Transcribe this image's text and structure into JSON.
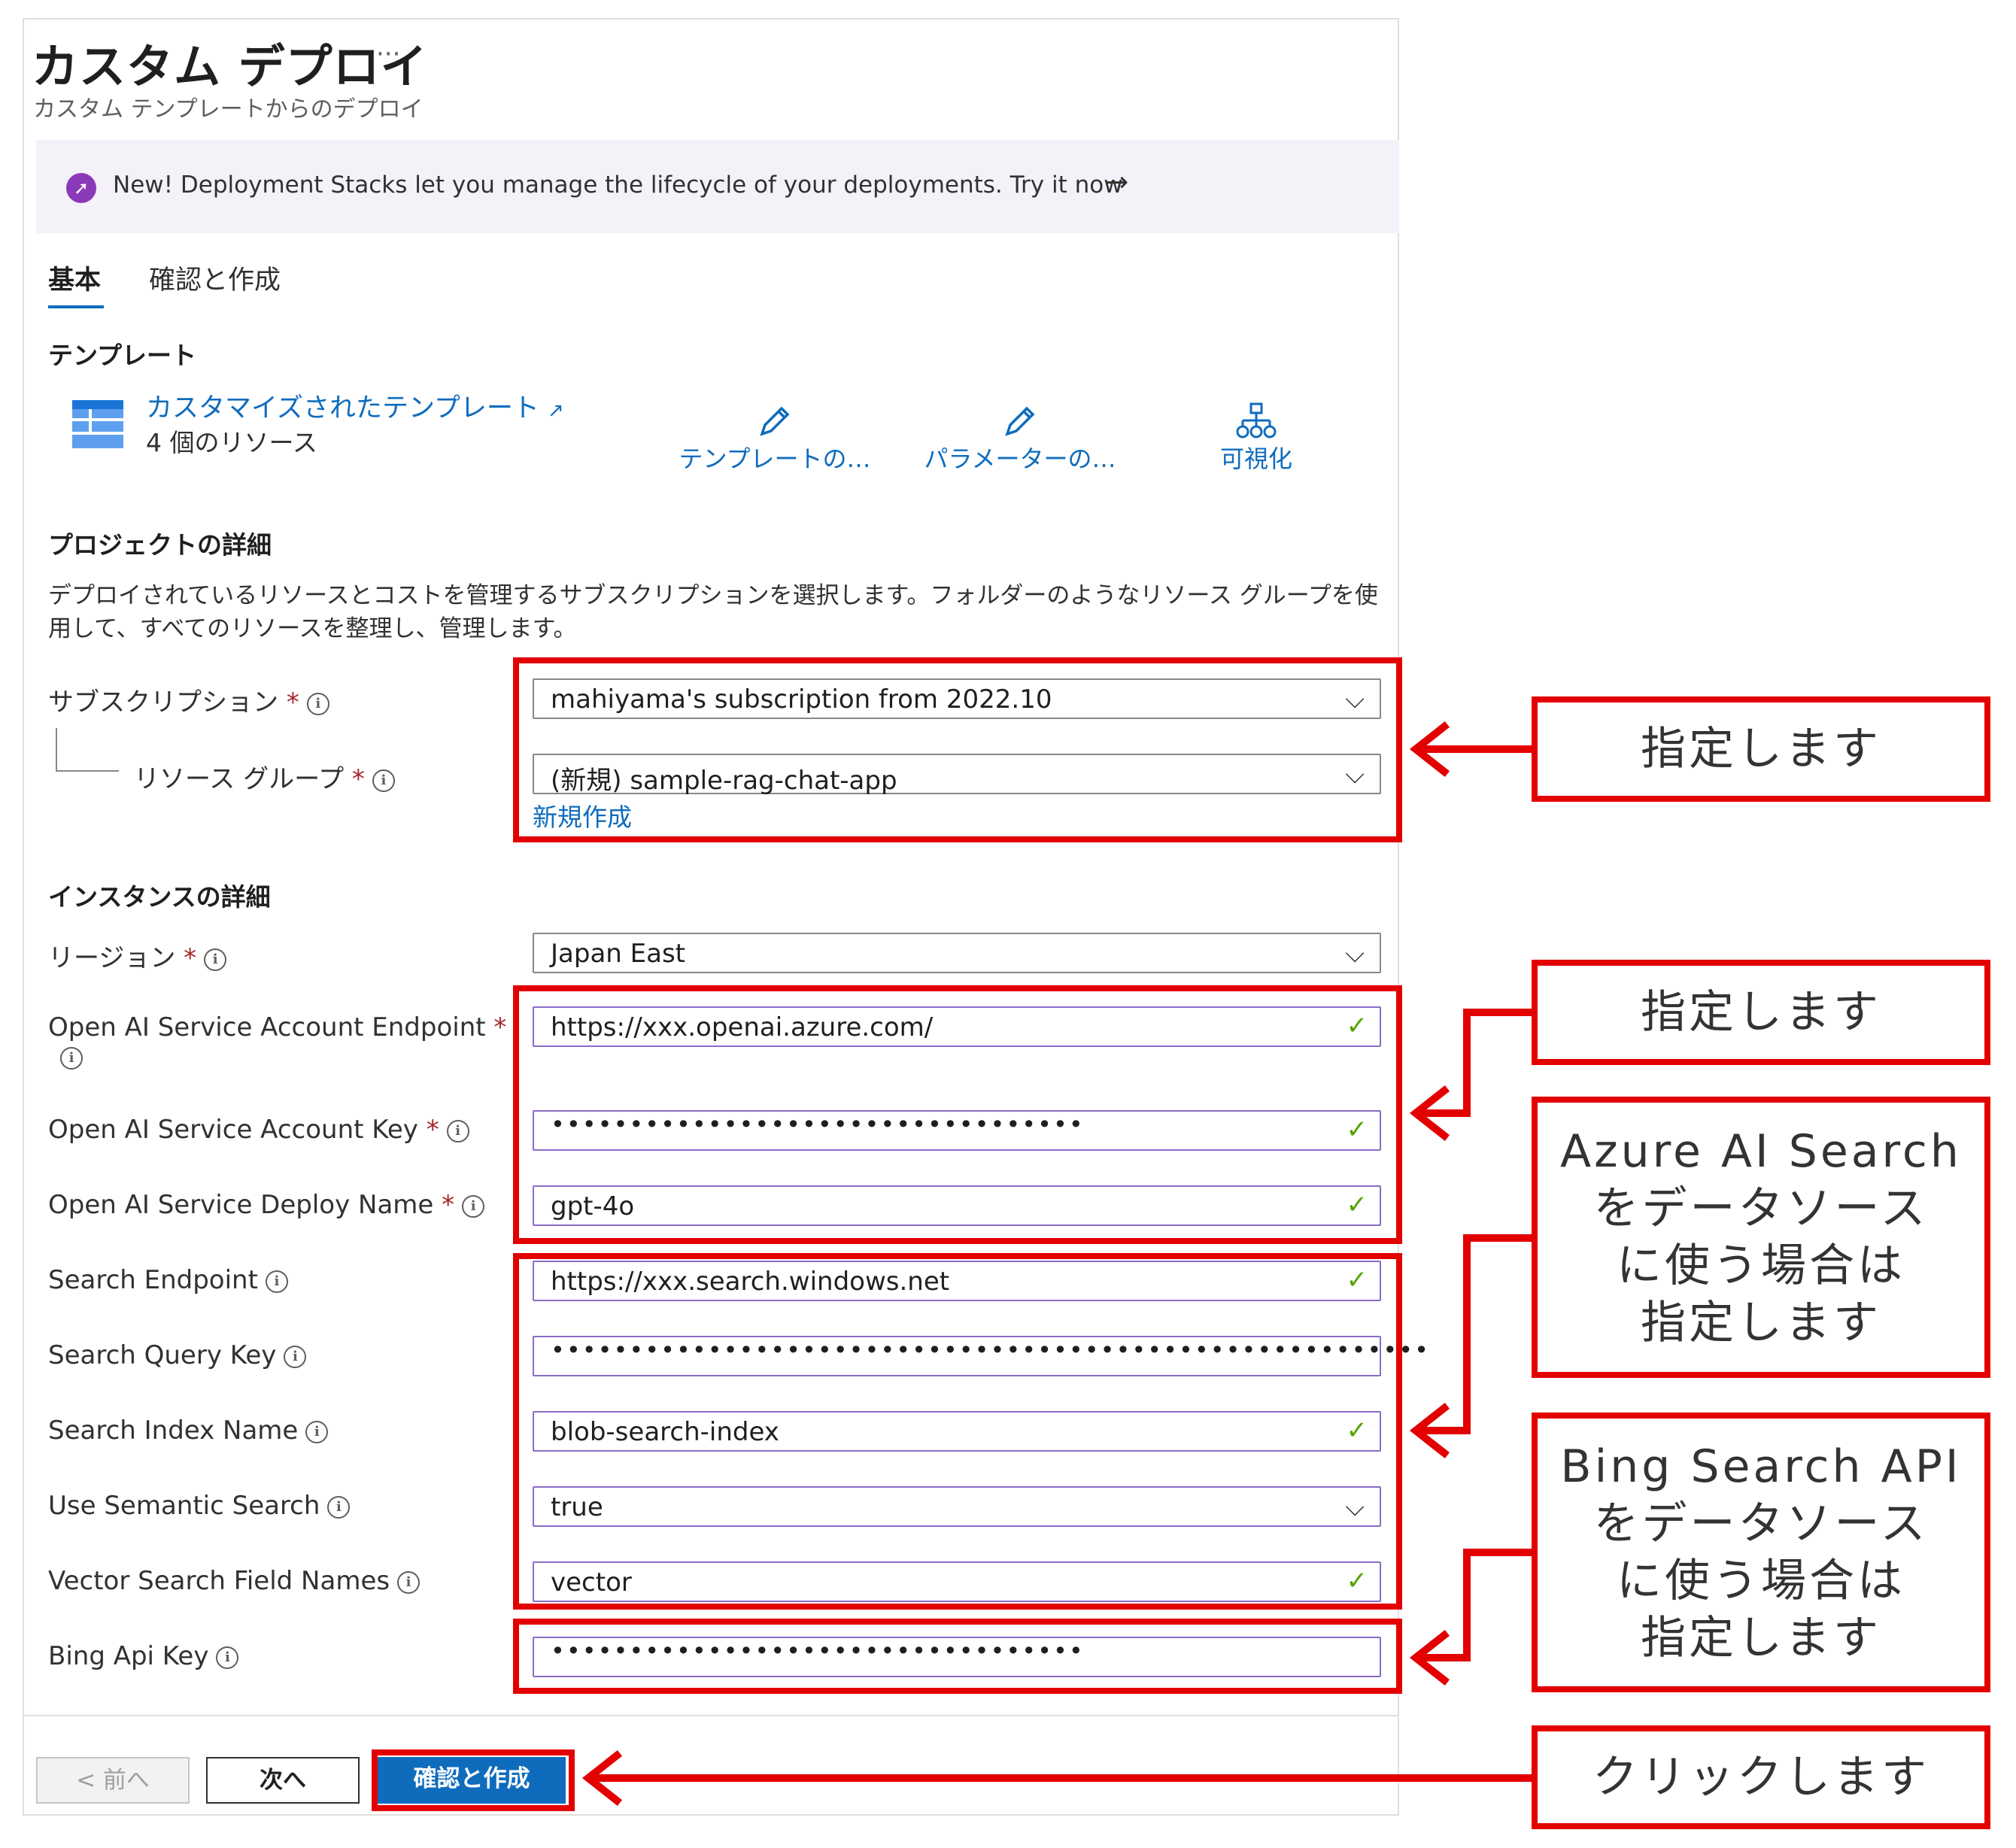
{
  "header": {
    "title": "カスタム デプロイ",
    "more": "···",
    "subtitle": "カスタム テンプレートからのデプロイ"
  },
  "banner": {
    "icon": "rocket-icon",
    "text": "New! Deployment Stacks let you manage the lifecycle of your deployments. Try it now",
    "arrow": "→"
  },
  "tabs": [
    {
      "label": "基本",
      "active": true
    },
    {
      "label": "確認と作成",
      "active": false
    }
  ],
  "template": {
    "heading": "テンプレート",
    "link": "カスタマイズされたテンプレート",
    "link_icon": "external-link-icon",
    "count": "4 個のリソース",
    "actions": [
      {
        "label": "テンプレートの…",
        "icon": "pencil-icon"
      },
      {
        "label": "パラメーターの…",
        "icon": "pencil-icon"
      },
      {
        "label": "可視化",
        "icon": "hierarchy-icon"
      }
    ]
  },
  "project": {
    "heading": "プロジェクトの詳細",
    "description": "デプロイされているリソースとコストを管理するサブスクリプションを選択します。フォルダーのようなリソース グループを使用して、すべてのリソースを整理し、管理します。",
    "subscription_label": "サブスクリプション",
    "subscription_value": "mahiyama's subscription from 2022.10",
    "resource_group_label": "リソース グループ",
    "resource_group_value": "(新規) sample-rag-chat-app",
    "new_link": "新規作成"
  },
  "instance": {
    "heading": "インスタンスの詳細",
    "fields": [
      {
        "label": "リージョン",
        "required": "*",
        "value": "Japan East",
        "kind": "select"
      },
      {
        "label": "Open AI Service Account Endpoint",
        "required": "*",
        "value": "https://xxx.openai.azure.com/",
        "kind": "text"
      },
      {
        "label": "Open AI Service Account Key",
        "required": "*",
        "value": "••••••••••••••••••••••••••••••••••",
        "kind": "password"
      },
      {
        "label": "Open AI Service Deploy Name",
        "required": "*",
        "value": "gpt-4o",
        "kind": "text"
      },
      {
        "label": "Search Endpoint",
        "value": "https://xxx.search.windows.net",
        "kind": "text"
      },
      {
        "label": "Search Query Key",
        "value": "••••••••••••••••••••••••••••••••••••••••••••••••••••••••",
        "kind": "password"
      },
      {
        "label": "Search Index Name",
        "value": "blob-search-index",
        "kind": "text"
      },
      {
        "label": "Use Semantic Search",
        "value": "true",
        "kind": "select"
      },
      {
        "label": "Vector Search Field Names",
        "value": "vector",
        "kind": "text"
      },
      {
        "label": "Bing Api Key",
        "value": "••••••••••••••••••••••••••••••••••",
        "kind": "password"
      }
    ]
  },
  "footer": {
    "prev": "< 前へ",
    "next": "次へ",
    "create": "確認と作成"
  },
  "callouts": {
    "specify": "指定します",
    "azure_search": "Azure AI Search\nをデータソース\nに使う場合は\n指定します",
    "bing": "Bing Search API\nをデータソース\nに使う場合は\n指定します",
    "click": "クリックします"
  },
  "colors": {
    "accent": "#0f6cbd",
    "annotation": "#e30000",
    "required": "#a4262c",
    "valid": "#57a300"
  }
}
